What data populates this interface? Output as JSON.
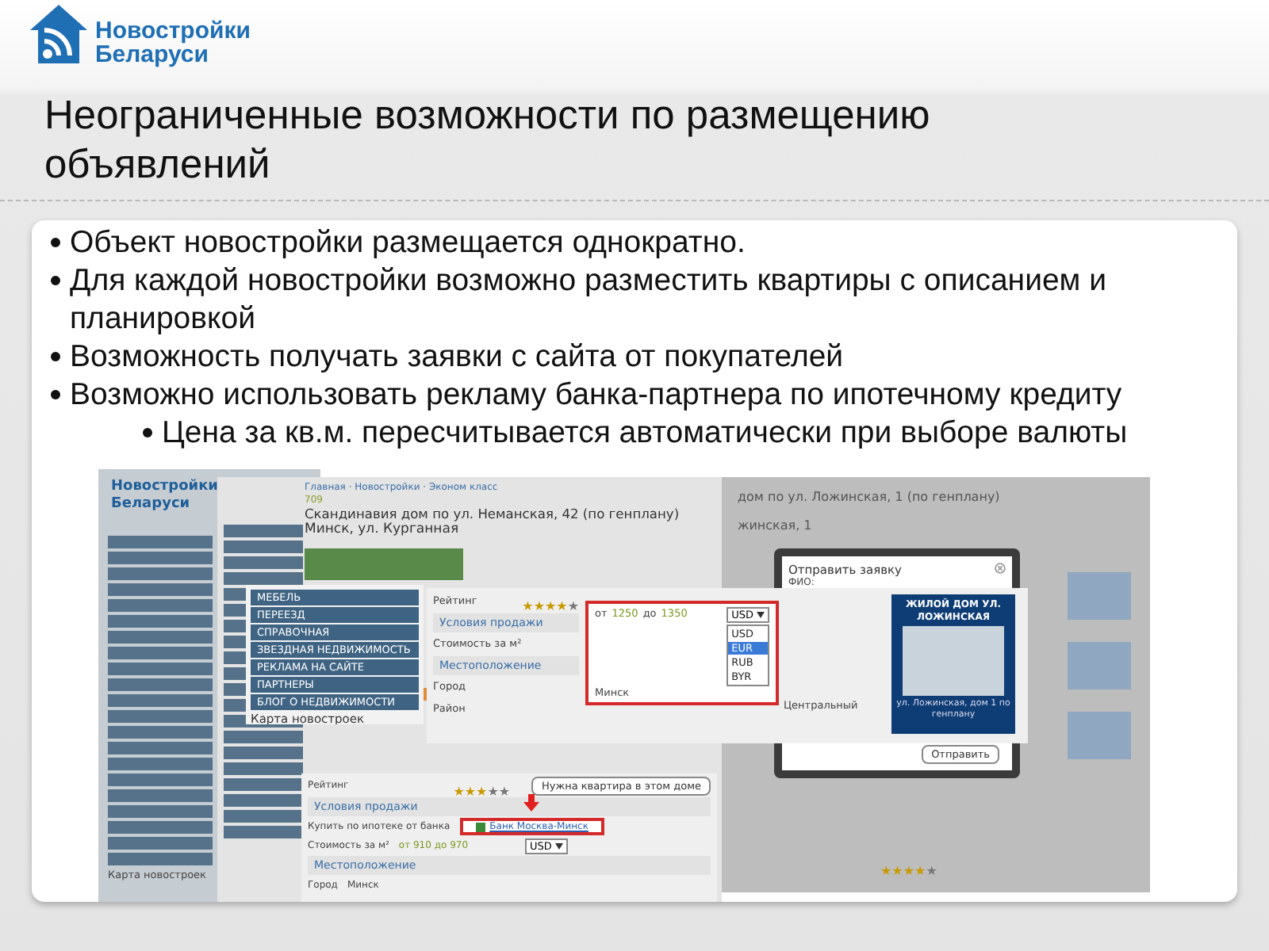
{
  "logo": {
    "line1": "Новостройки",
    "line2": "Беларуси"
  },
  "title": "Неограниченные возможности по размещению объявлений",
  "bullets": [
    {
      "kind": "main",
      "text": "Объект новостройки размещается однократно."
    },
    {
      "kind": "main",
      "text": "Для каждой новостройки возможно разместить квартиры с описанием и планировкой"
    },
    {
      "kind": "main",
      "text": "Возможность получать заявки с сайта от покупателей"
    },
    {
      "kind": "main",
      "text": "Возможно использовать рекламу банка-партнера по ипотечному кредиту"
    },
    {
      "kind": "sub",
      "text": "Цена за кв.м. пересчитывается автоматически при выборе валюты"
    }
  ],
  "collage": {
    "site_a": {
      "logo_line1": "Новостройки",
      "logo_line2": "Беларуси",
      "map_label": "Карта новостроек"
    },
    "site_b": {
      "breadcrumb": "Главная · Новостройки · Эконом класс",
      "views": "709",
      "heading": "Скандинавия дом по ул. Неманская, 42 (по генплану)",
      "address": "Минск, ул. Курганная"
    },
    "menu": {
      "items": [
        "МЕБЕЛЬ",
        "ПЕРЕЕЗД",
        "СПРАВОЧНАЯ",
        "ЗВЕЗДНАЯ НЕДВИЖИМОСТЬ",
        "РЕКЛАМА НА САЙТЕ",
        "ПАРТНЕРЫ",
        "БЛОГ О НЕДВИЖИМОСТИ"
      ],
      "map_label": "Карта новостроек"
    },
    "details": {
      "rating_label": "Рейтинг",
      "stars": 4,
      "sale_header": "Условия продажи",
      "price_label": "Стоимость за м²",
      "price_from": "от",
      "price_min": "1250",
      "price_to": "до",
      "price_max": "1350",
      "currency": "USD",
      "currency_options": [
        {
          "label": "USD",
          "selected": false
        },
        {
          "label": "EUR",
          "selected": true
        },
        {
          "label": "RUB",
          "selected": false
        },
        {
          "label": "BYR",
          "selected": false
        }
      ],
      "location_header": "Местоположение",
      "city_label": "Город",
      "city": "Минск",
      "district_label": "Район",
      "district": "Центральный",
      "card_title": "ЖИЛОЙ ДОМ УЛ. ЛОЖИНСКАЯ",
      "card_caption": "ул. Ложинская, дом 1 по генплану"
    },
    "lower": {
      "rating_label": "Рейтинг",
      "stars": 3,
      "need_button": "Нужна квартира в этом доме",
      "sale_header": "Условия продажи",
      "mortgage_label": "Купить по ипотеке от банка",
      "bank_link": "Банк Москва-Минск",
      "price_label": "Стоимость за м²",
      "price": "от 910 до 970",
      "currency": "USD",
      "location_header": "Местоположение",
      "city_label": "Город",
      "city": "Минск"
    },
    "site_c": {
      "heading": "дом по ул. Ложинская, 1 (по генплану)",
      "address": "жинская, 1",
      "modal_title": "Отправить заявку",
      "name_label": "ФИО:",
      "send_button": "Отправить",
      "stars": 4
    }
  }
}
